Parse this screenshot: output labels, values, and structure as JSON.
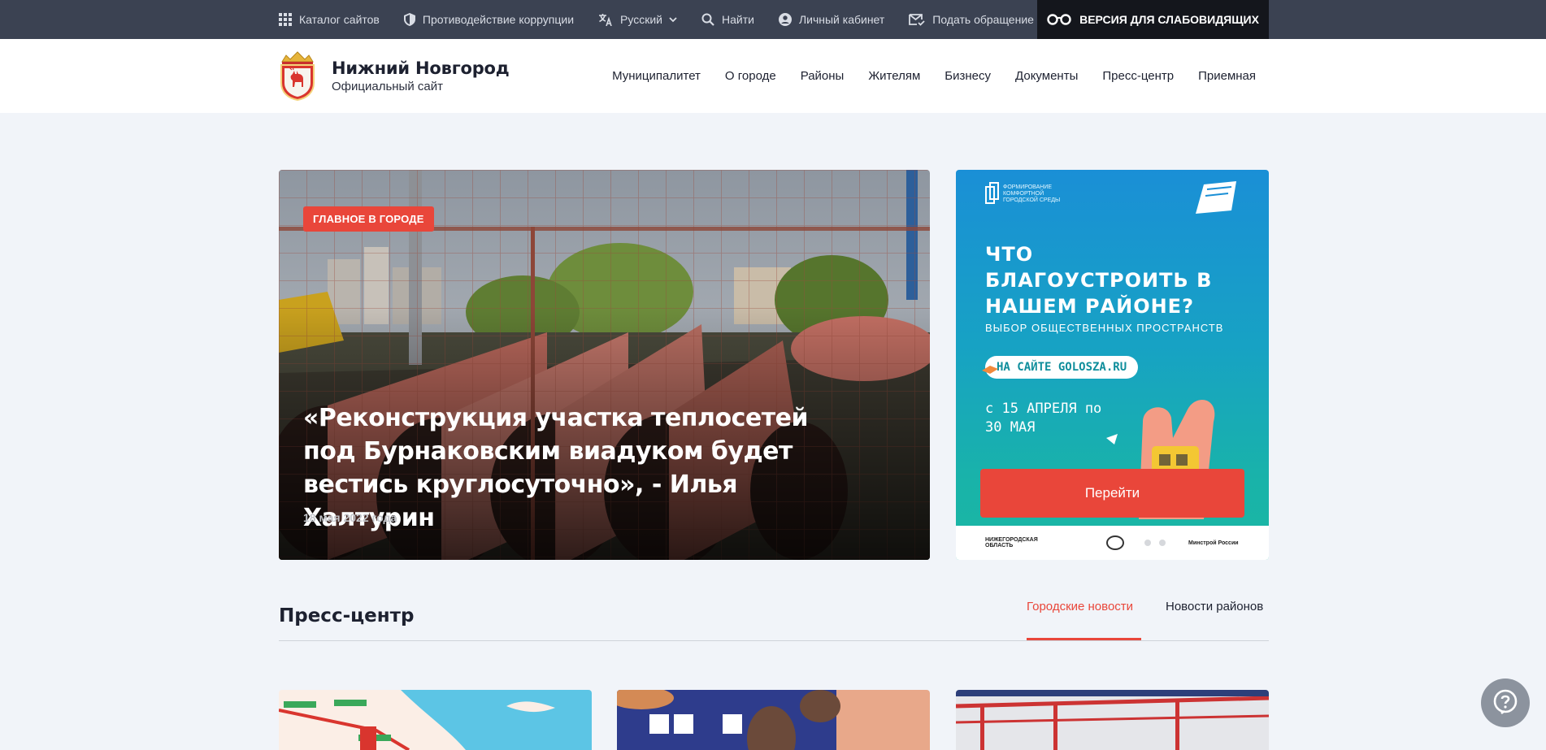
{
  "topbar": {
    "catalog": "Каталог сайтов",
    "anticorruption": "Противодействие коррупции",
    "language": "Русский",
    "search": "Найти",
    "account": "Личный кабинет",
    "appeal": "Подать обращение",
    "impaired": "ВЕРСИЯ ДЛЯ СЛАБОВИДЯЩИХ"
  },
  "header": {
    "title": "Нижний Новгород",
    "subtitle": "Официальный сайт",
    "nav": [
      "Муниципалитет",
      "О городе",
      "Районы",
      "Жителям",
      "Бизнесу",
      "Документы",
      "Пресс-центр",
      "Приемная"
    ]
  },
  "hero": {
    "badge": "ГЛАВНОЕ В ГОРОДЕ",
    "title": "«Реконструкция участка теплосетей под Бурнаковским виадуком будет вестись круглосуточно», - Илья Халтурин",
    "date": "18 мая 2022 года"
  },
  "banner": {
    "brand": "ФОРМИРОВАНИЕ КОМФОРТНОЙ ГОРОДСКОЙ СРЕДЫ",
    "question": "ЧТО БЛАГОУСТРОИТЬ В НАШЕМ РАЙОНЕ?",
    "spaces": "ВЫБОР ОБЩЕСТВЕННЫХ ПРОСТРАНСТВ",
    "site": "НА САЙТЕ GOLOSZA.RU",
    "dates": "с 15 АПРЕЛЯ по 30 МАЯ",
    "button": "Перейти",
    "logo_region": "НИЖЕГОРОДСКАЯ ОБЛАСТЬ",
    "logo_ministry": "Минстрой России"
  },
  "press": {
    "title": "Пресс-центр",
    "tab_city": "Городские новости",
    "tab_districts": "Новости районов"
  },
  "colors": {
    "accent": "#e9463a",
    "topbar": "#3b4252",
    "background": "#f1f4f9"
  }
}
